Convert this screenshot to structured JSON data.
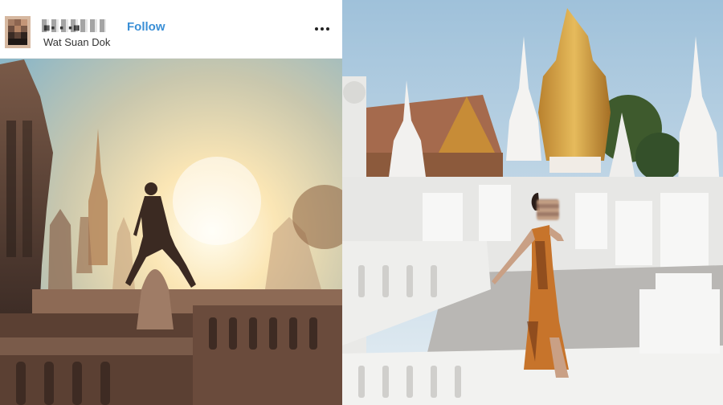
{
  "post": {
    "username": "■▪ ▪ ▪■",
    "follow_label": "Follow",
    "location": "Wat Suan Dok"
  },
  "icons": {
    "more": "more-options-icon",
    "avatar": "profile-avatar"
  },
  "colors": {
    "follow": "#3a8fd6",
    "gold_stupa": "#d7a640",
    "sky_left": "#f4d9a5",
    "sky_right": "#a9c6da"
  }
}
